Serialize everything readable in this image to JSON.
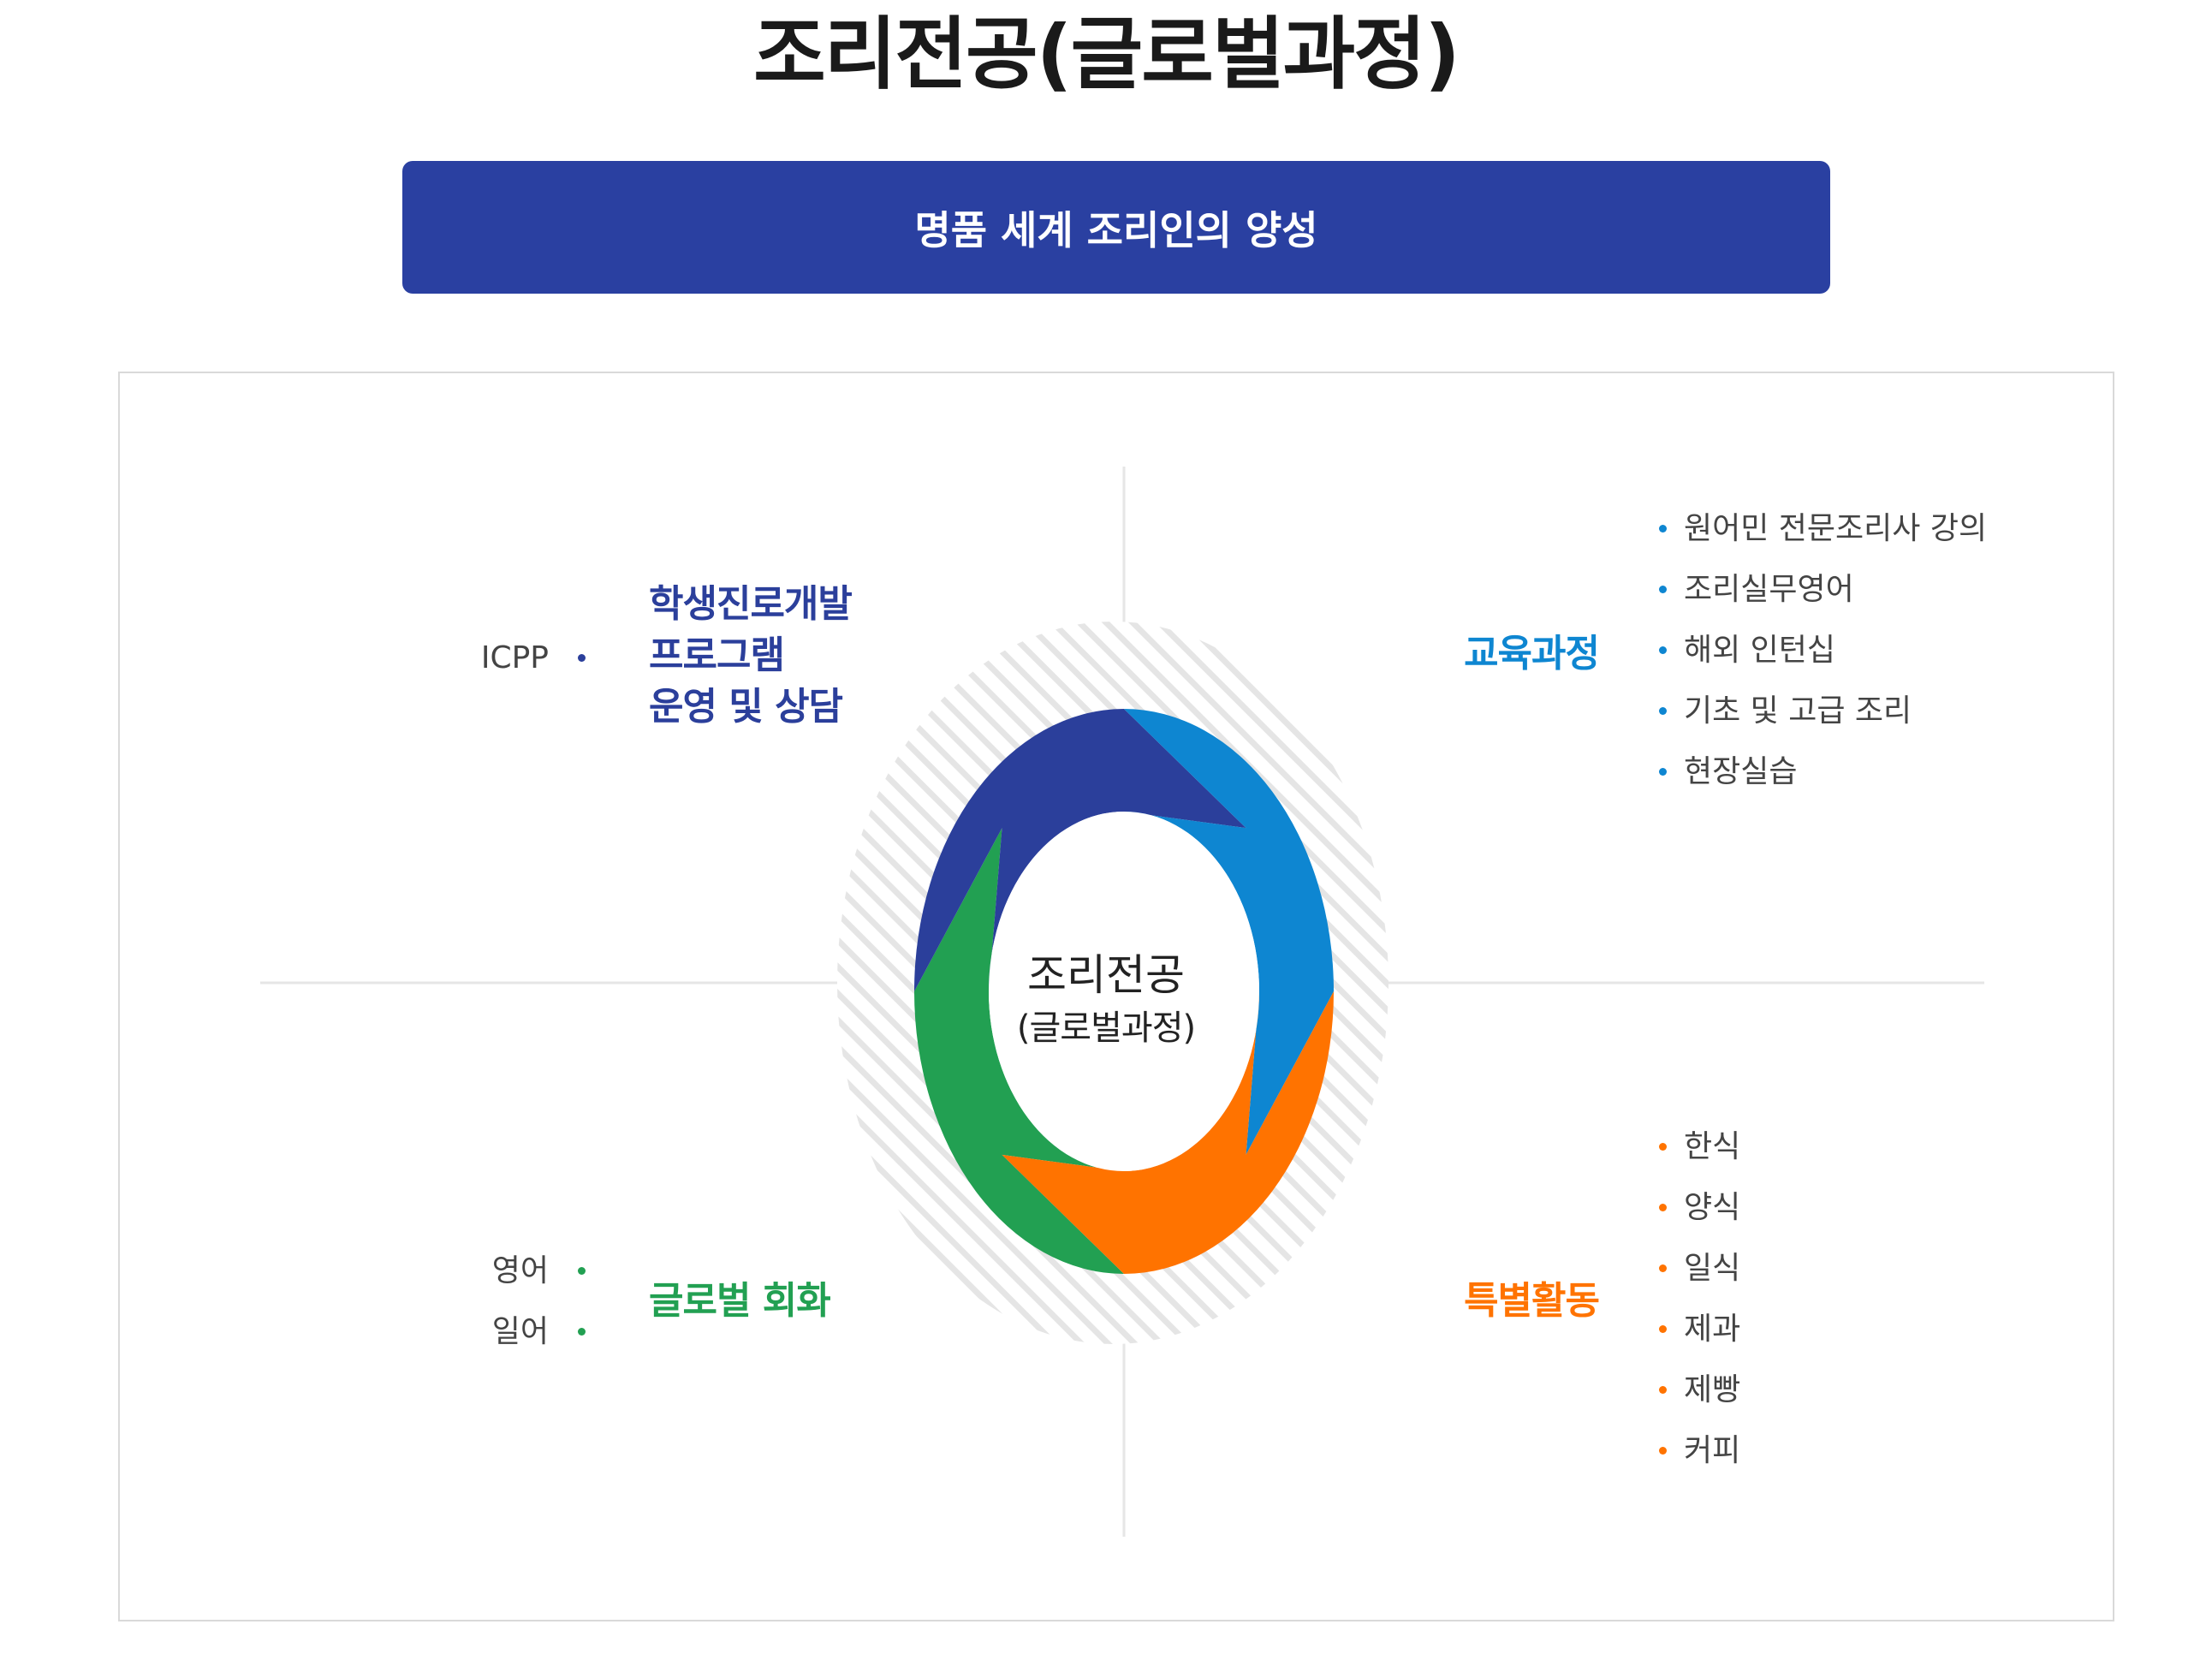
{
  "page_title": "조리전공(글로벌과정)",
  "banner_text": "명품 세계 조리인의 양성",
  "center": {
    "line1": "조리전공",
    "line2": "(글로벌과정)"
  },
  "quadrants": {
    "top_left": {
      "heading": [
        "학생진로개발",
        "프로그램",
        "운영 및 상담"
      ],
      "items": [
        "ICPP"
      ],
      "color": "#2b3f9b"
    },
    "top_right": {
      "heading": "교육과정",
      "items": [
        "원어민 전문조리사 강의",
        "조리실무영어",
        "해외 인턴십",
        "기초 및 고급 조리",
        "현장실습"
      ],
      "color": "#0e86d1"
    },
    "bottom_left": {
      "heading": "글로벌 회화",
      "items": [
        "영어",
        "일어"
      ],
      "color": "#22a052"
    },
    "bottom_right": {
      "heading": "특별활동",
      "items": [
        "한식",
        "양식",
        "일식",
        "제과",
        "제빵",
        "커피"
      ],
      "color": "#ff7300"
    }
  },
  "colors": {
    "banner": "#2a40a1",
    "divider": "#e6e6e6",
    "hatch": "#e5e5e5",
    "panel_border": "#d9d9d9"
  }
}
